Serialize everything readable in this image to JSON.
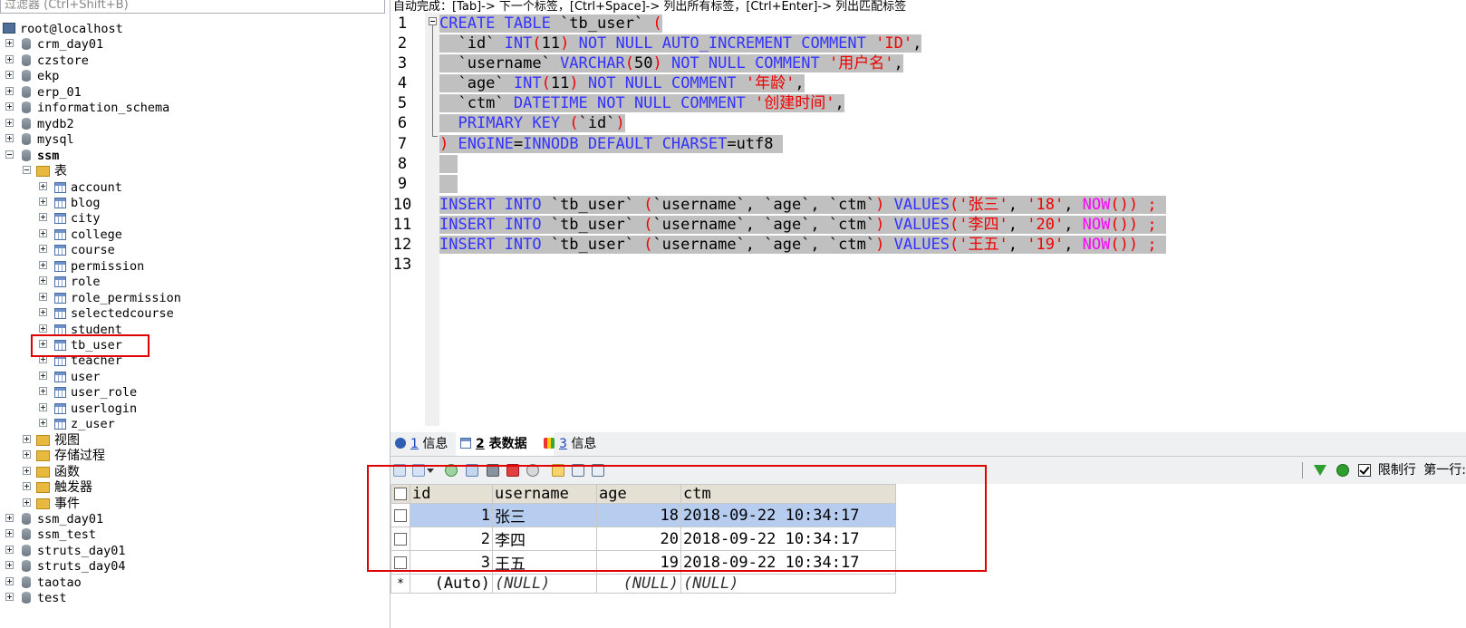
{
  "filter": {
    "placeholder": "过滤器 (Ctrl+Shift+B)"
  },
  "tree": {
    "root": "root@localhost",
    "databases_before": [
      "crm_day01",
      "czstore",
      "ekp",
      "erp_01",
      "information_schema",
      "mydb2",
      "mysql"
    ],
    "open_db": "ssm",
    "tables_folder": "表",
    "tables": [
      "account",
      "blog",
      "city",
      "college",
      "course",
      "permission",
      "role",
      "role_permission",
      "selectedcourse",
      "student",
      "tb_user",
      "teacher",
      "user",
      "user_role",
      "userlogin",
      "z_user"
    ],
    "other_folders": [
      "视图",
      "存储过程",
      "函数",
      "触发器",
      "事件"
    ],
    "databases_after": [
      "ssm_day01",
      "ssm_test",
      "struts_day01",
      "struts_day04",
      "taotao",
      "test"
    ]
  },
  "editor": {
    "hint": "自动完成：[Tab]-> 下一个标签，[Ctrl+Space]-> 列出所有标签，[Ctrl+Enter]-> 列出匹配标签",
    "line_numbers": [
      "1",
      "2",
      "3",
      "4",
      "5",
      "6",
      "7",
      "8",
      "9",
      "10",
      "11",
      "12",
      "13"
    ]
  },
  "tabs": [
    {
      "num": "1",
      "label": "信息",
      "icon": "info-icon"
    },
    {
      "num": "2",
      "label": "表数据",
      "icon": "table-data-icon"
    },
    {
      "num": "3",
      "label": "信息",
      "icon": "info-icon"
    }
  ],
  "right_tools": {
    "limit_label": "限制行",
    "first_row_label": "第一行:"
  },
  "grid": {
    "columns": [
      "id",
      "username",
      "age",
      "ctm"
    ],
    "rows": [
      {
        "id": "1",
        "username": "张三",
        "age": "18",
        "ctm": "2018-09-22 10:34:17"
      },
      {
        "id": "2",
        "username": "李四",
        "age": "20",
        "ctm": "2018-09-22 10:34:17"
      },
      {
        "id": "3",
        "username": "王五",
        "age": "19",
        "ctm": "2018-09-22 10:34:17"
      }
    ],
    "new_row": {
      "marker": "*",
      "id": "(Auto)",
      "username": "(NULL)",
      "age": "(NULL)",
      "ctm": "(NULL)"
    }
  },
  "colors": {
    "keyword": "#3333ff",
    "string": "#ee0000",
    "function": "#ff00ff",
    "highlight_box": "#e00000",
    "selection": "#c0c0c0"
  }
}
